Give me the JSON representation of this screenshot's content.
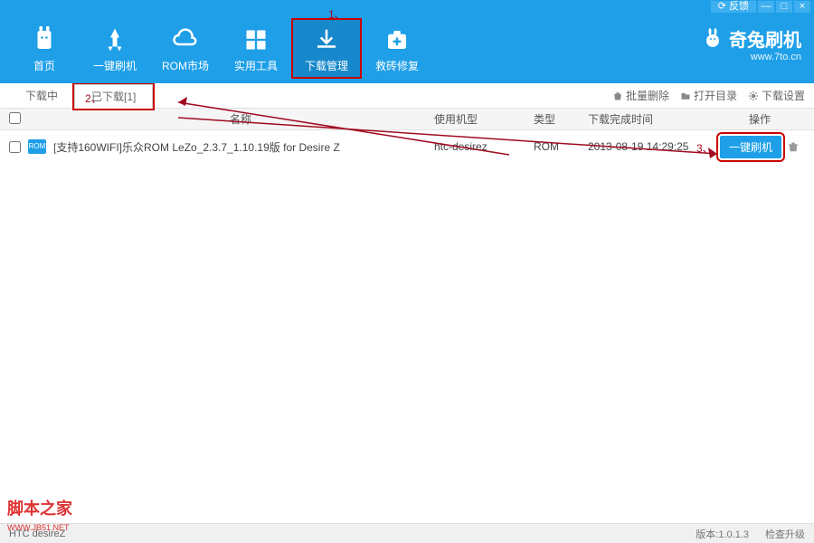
{
  "titlebar": {
    "feedback": "反馈",
    "minimize": "—",
    "maximize": "□",
    "close": "×"
  },
  "brand": {
    "name": "奇兔刷机",
    "url": "www.7to.cn"
  },
  "nav": [
    {
      "label": "首页",
      "icon": "rabbit"
    },
    {
      "label": "一键刷机",
      "icon": "rocket"
    },
    {
      "label": "ROM市场",
      "icon": "cloud"
    },
    {
      "label": "实用工具",
      "icon": "grid"
    },
    {
      "label": "下载管理",
      "icon": "download",
      "active": true
    },
    {
      "label": "救砖修复",
      "icon": "medkit"
    }
  ],
  "tool_tabs": {
    "downloading": "下载中",
    "downloaded": "已下载[1]"
  },
  "tool_right": {
    "batch_delete": "批量删除",
    "open_dir": "打开目录",
    "dl_settings": "下载设置"
  },
  "columns": {
    "name": "名称",
    "model": "使用机型",
    "type": "类型",
    "time": "下载完成时间",
    "action": "操作"
  },
  "rows": [
    {
      "name": "[支持160WIFI]乐众ROM LeZo_2.3.7_1.10.19版 for Desire Z",
      "model": "htc-desirez",
      "type": "ROM",
      "time": "2013-08-19 14:29:25",
      "action_label": "一键刷机"
    }
  ],
  "footer": {
    "device": "HTC desireZ",
    "version": "版本:1.0.1.3",
    "check": "检查升级"
  },
  "watermark": {
    "main": "脚本之家",
    "sub": "WWW.JB51.NET"
  },
  "annotations": {
    "a1": "1、",
    "a2": "2、",
    "a3": "3、"
  }
}
